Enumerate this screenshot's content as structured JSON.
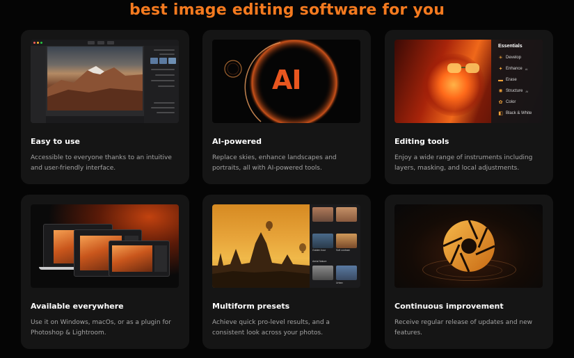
{
  "page": {
    "headline": "best image editing software for you"
  },
  "colors": {
    "accent": "#f47a1f",
    "card_bg": "#151515",
    "page_bg": "#050505"
  },
  "cards": [
    {
      "title": "Easy to use",
      "description": "Accessible to everyone thanks to an intuitive and user-friendly interface.",
      "media": "editor-screenshot"
    },
    {
      "title": "AI-powered",
      "description": "Replace skies, enhance landscapes and portraits, all with AI-powered tools.",
      "media": "ai-logo",
      "media_text": "AI"
    },
    {
      "title": "Editing tools",
      "description": "Enjoy a wide range of instruments including layers, masking, and local adjustments.",
      "media": "essentials-menu",
      "menu": {
        "title": "Essentials",
        "items": [
          {
            "label": "Develop",
            "icon": "sun-icon"
          },
          {
            "label": "Enhance",
            "badge": "AI",
            "icon": "sparkle-icon"
          },
          {
            "label": "Erase",
            "icon": "eraser-icon"
          },
          {
            "label": "Structure",
            "badge": "AI",
            "icon": "structure-icon"
          },
          {
            "label": "Color",
            "icon": "color-icon"
          },
          {
            "label": "Black & White",
            "icon": "black-white-icon"
          }
        ]
      }
    },
    {
      "title": "Available everywhere",
      "description": "Use it on Windows, macOs, or as a plugin for Photoshop & Lightroom.",
      "media": "devices"
    },
    {
      "title": "Multiform presets",
      "description": "Achieve quick pro-level results, and a consistent look across your photos.",
      "media": "presets",
      "preset_labels": [
        "Golden hour",
        "Soft contrast",
        "Aerial Nature",
        "Urban"
      ]
    },
    {
      "title": "Continuous improvement",
      "description": "Receive regular release of updates and new features.",
      "media": "aperture-logo"
    }
  ]
}
